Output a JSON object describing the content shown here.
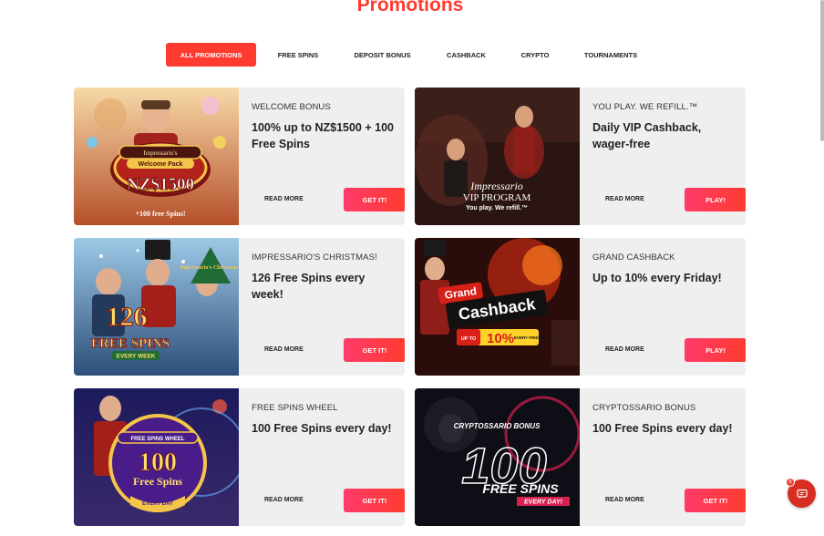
{
  "page_title": "Promotions",
  "tabs": [
    {
      "label": "ALL PROMOTIONS",
      "active": true
    },
    {
      "label": "FREE SPINS"
    },
    {
      "label": "DEPOSIT BONUS"
    },
    {
      "label": "CASHBACK"
    },
    {
      "label": "CRYPTO"
    },
    {
      "label": "TOURNAMENTS"
    }
  ],
  "cards": [
    {
      "kicker": "WELCOME BONUS",
      "headline": "100% up to NZ$1500 + 100 Free Spins",
      "read_more": "READ MORE",
      "cta": "GET IT!",
      "image_text": {
        "line1": "Impressario's",
        "line2": "Welcome Pack",
        "amount": "NZ$1500",
        "sub": "+100 free Spins!"
      }
    },
    {
      "kicker": "YOU PLAY. WE REFILL.™",
      "headline": "Daily VIP Cashback, wager-free",
      "read_more": "READ MORE",
      "cta": "PLAY!",
      "image_text": {
        "line1": "Impressario",
        "line2": "VIP PROGRAM",
        "sub": "You play. We refill.™"
      }
    },
    {
      "kicker": "IMPRESSARIO'S CHRISTMAS!",
      "headline": "126 Free Spins every week!",
      "read_more": "READ MORE",
      "cta": "GET IT!",
      "image_text": {
        "line1": "Impressario's Christmas",
        "amount": "126",
        "line2": "FREE SPINS",
        "sub": "EVERY WEEK"
      }
    },
    {
      "kicker": "GRAND CASHBACK",
      "headline": "Up to 10% every Friday!",
      "read_more": "READ MORE",
      "cta": "PLAY!",
      "image_text": {
        "line1": "Grand",
        "line2": "Cashback",
        "amount": "10%",
        "pre": "UP TO",
        "sub": "EVERY FRIDAY!"
      }
    },
    {
      "kicker": "FREE SPINS WHEEL",
      "headline": "100 Free Spins every day!",
      "read_more": "READ MORE",
      "cta": "GET IT!",
      "image_text": {
        "line1": "FREE SPINS WHEEL",
        "amount": "100",
        "line2": "Free Spins",
        "sub": "EVERY DAY"
      }
    },
    {
      "kicker": "CRYPTOSSARIO BONUS",
      "headline": "100 Free Spins every day!",
      "read_more": "READ MORE",
      "cta": "GET IT!",
      "image_text": {
        "line1": "CRYPTOSSARIO BONUS",
        "amount": "100",
        "line2": "FREE SPINS",
        "sub": "EVERY DAY!"
      }
    }
  ],
  "chat": {
    "badge": "6",
    "icon": "chat-icon"
  },
  "colors": {
    "accent": "#ff3b2f",
    "card_bg": "#efefef"
  }
}
